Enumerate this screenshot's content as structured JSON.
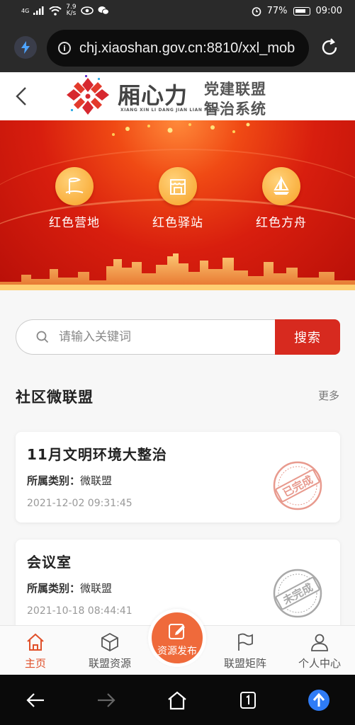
{
  "status_bar": {
    "signal_label": "4G",
    "net_speed_value": "7.9",
    "net_speed_unit": "K/s",
    "battery": "77%",
    "time": "09:00"
  },
  "browser": {
    "url": "chj.xiaoshan.gov.cn:8810/xxl_mob"
  },
  "header": {
    "logo_main": "厢心力",
    "logo_pinyin": "XIANG XIN LI DANG JIAN LIAN MENG",
    "logo_line1": "党建联盟",
    "logo_line2": "智治系统"
  },
  "banner": {
    "features": [
      {
        "label": "红色营地",
        "icon": "flag-map-icon"
      },
      {
        "label": "红色驿站",
        "icon": "station-icon"
      },
      {
        "label": "红色方舟",
        "icon": "sailboat-icon"
      }
    ]
  },
  "search": {
    "placeholder": "请输入关键词",
    "button_label": "搜索"
  },
  "section": {
    "title": "社区微联盟",
    "more_label": "更多"
  },
  "cards": [
    {
      "title": "11月文明环境大整治",
      "category_label": "所属类别：",
      "category_value": "微联盟",
      "time": "2021-12-02 09:31:45",
      "stamp": "已完成",
      "stamp_color": "#e89a8e"
    },
    {
      "title": "会议室",
      "category_label": "所属类别：",
      "category_value": "微联盟",
      "time": "2021-10-18 08:44:41",
      "stamp": "未完成",
      "stamp_color": "#a9a9a9"
    }
  ],
  "tabbar": {
    "tabs": [
      {
        "label": "主页",
        "icon": "home-icon",
        "active": true
      },
      {
        "label": "联盟资源",
        "icon": "cube-icon",
        "active": false
      },
      {
        "label": "联盟矩阵",
        "icon": "flag-icon",
        "active": false
      },
      {
        "label": "个人中心",
        "icon": "user-icon",
        "active": false
      }
    ],
    "publish_label": "资源发布"
  },
  "colors": {
    "accent": "#d72a1f",
    "tab_active": "#e0502a",
    "publish": "#ef6a3b"
  }
}
